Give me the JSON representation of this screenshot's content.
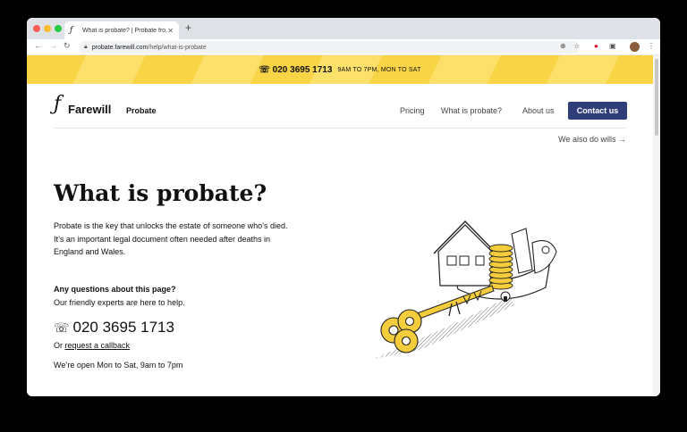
{
  "browser": {
    "tab_title": "What is probate? | Probate fro...",
    "tab_favicon": "ƒ",
    "url_host": "probate.farewill.com",
    "url_path": "/help/what-is-probate",
    "icons": [
      "back-icon",
      "forward-icon",
      "reload-icon",
      "lock-icon",
      "zoom-icon",
      "star-icon",
      "pinterest-icon",
      "camera-icon",
      "profile-avatar",
      "menu-icon"
    ]
  },
  "banner": {
    "phone": "020 3695 1713",
    "hours": "9AM TO 7PM, MON TO SAT"
  },
  "header": {
    "logo_mark": "ƒ",
    "logo_text": "Farewill",
    "section": "Probate",
    "nav": [
      "Pricing",
      "What is probate?",
      "About us"
    ],
    "cta": "Contact us"
  },
  "wills_link": "We also do wills →",
  "hero": {
    "title": "What is probate?",
    "intro": "Probate is the key that unlocks the estate of someone who’s died. It’s an important legal document often needed after deaths in England and Wales.",
    "question_heading": "Any questions about this page?",
    "question_sub": "Our friendly experts are here to help.",
    "phone": "020 3695 1713",
    "callback_prefix": "Or ",
    "callback_link": "request a callback",
    "hours": "We’re open Mon to Sat, 9am to 7pm"
  },
  "colors": {
    "banner_yellow": "#f9d447",
    "cta_navy": "#2f3e78",
    "key_yellow": "#f5cd3c"
  }
}
